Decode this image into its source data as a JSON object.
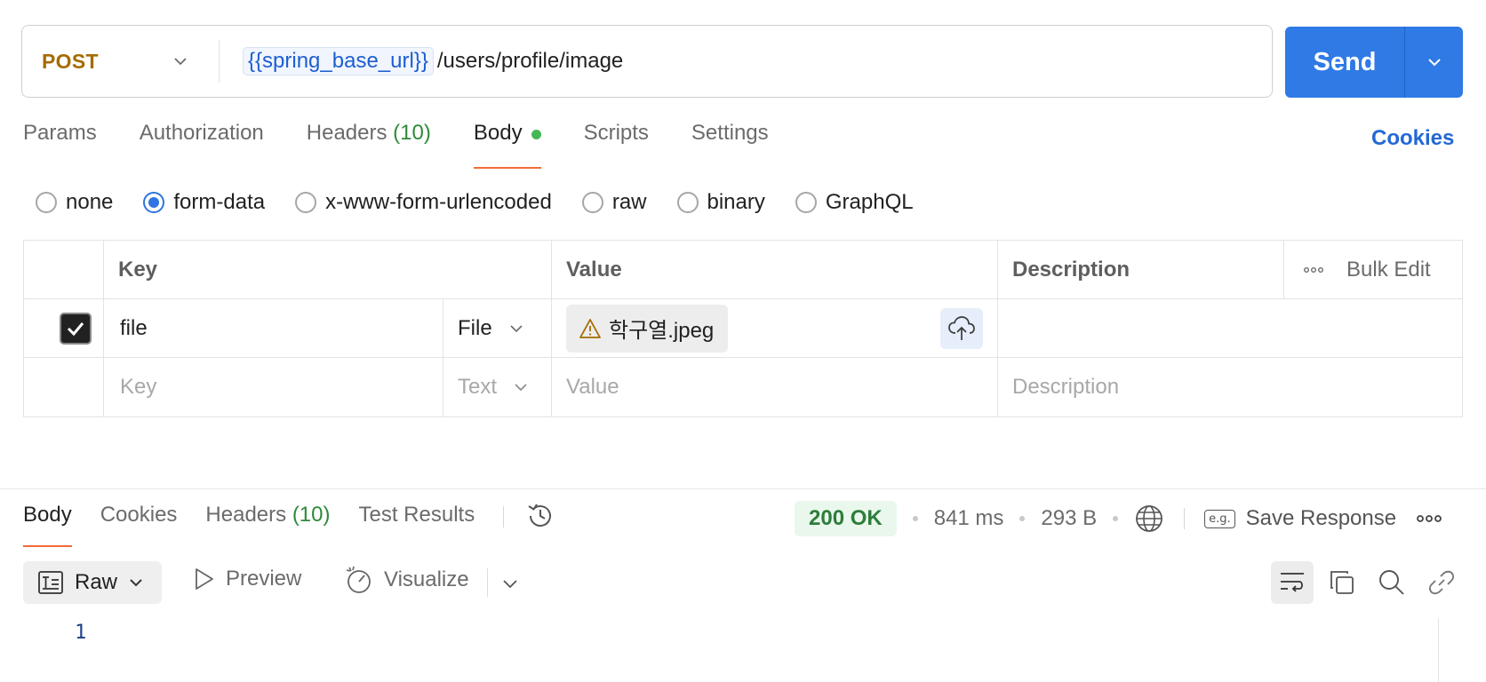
{
  "request": {
    "method": "POST",
    "url_variable": "{{spring_base_url}}",
    "url_path": "/users/profile/image",
    "send_label": "Send"
  },
  "request_tabs": [
    {
      "label": "Params"
    },
    {
      "label": "Authorization"
    },
    {
      "label": "Headers",
      "count": "(10)"
    },
    {
      "label": "Body",
      "active": true
    },
    {
      "label": "Scripts"
    },
    {
      "label": "Settings"
    }
  ],
  "cookies_label": "Cookies",
  "body_types": [
    {
      "label": "none",
      "selected": false
    },
    {
      "label": "form-data",
      "selected": true
    },
    {
      "label": "x-www-form-urlencoded",
      "selected": false
    },
    {
      "label": "raw",
      "selected": false
    },
    {
      "label": "binary",
      "selected": false
    },
    {
      "label": "GraphQL",
      "selected": false
    }
  ],
  "form_table": {
    "headers": {
      "key": "Key",
      "value": "Value",
      "description": "Description",
      "bulk_edit": "Bulk Edit"
    },
    "rows": [
      {
        "checked": true,
        "key": "file",
        "type": "File",
        "value": "학구열.jpeg",
        "description": ""
      }
    ],
    "new_row": {
      "key_placeholder": "Key",
      "type": "Text",
      "value_placeholder": "Value",
      "description_placeholder": "Description"
    }
  },
  "response": {
    "tabs": [
      {
        "label": "Body",
        "active": true
      },
      {
        "label": "Cookies"
      },
      {
        "label": "Headers",
        "count": "(10)"
      },
      {
        "label": "Test Results"
      }
    ],
    "status": "200 OK",
    "time": "841 ms",
    "size": "293 B",
    "save_label": "Save Response",
    "save_icon_text": "e.g.",
    "format": "Raw",
    "preview_label": "Preview",
    "visualize_label": "Visualize",
    "line_number": "1"
  },
  "colors": {
    "accent": "#2f7ae5",
    "method": "#a66b00",
    "tab_underline": "#f26b3a",
    "status_ok": "#2d7d3a"
  },
  "icons": [
    "chevron-down-icon",
    "history-icon",
    "globe-icon",
    "save-response-icon",
    "more-icon",
    "raw-format-icon",
    "play-icon",
    "visualize-icon",
    "wrap-icon",
    "copy-icon",
    "search-icon",
    "link-icon",
    "warning-icon",
    "cloud-upload-icon",
    "checkmark-icon"
  ]
}
